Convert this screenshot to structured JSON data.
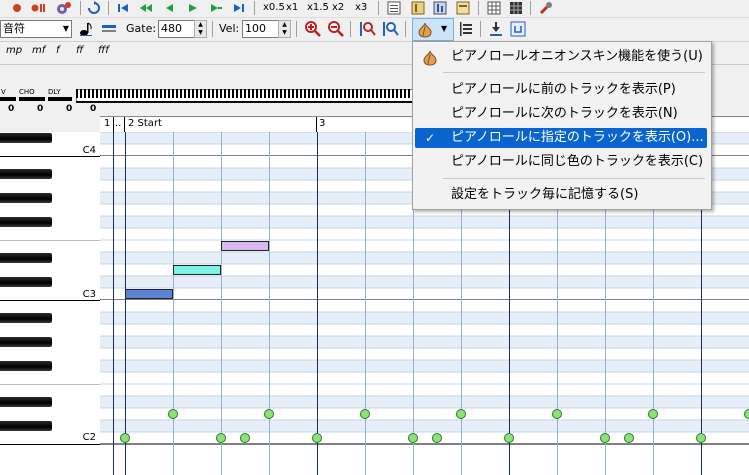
{
  "toolbar1": {
    "zoom_buttons": [
      "x0.5",
      "x1",
      "x1.5",
      "x2",
      "x3"
    ]
  },
  "toolbar2": {
    "note_combo_value": "音符",
    "gate_label": "Gate:",
    "gate_value": "480",
    "vel_label": "Vel:",
    "vel_value": "100"
  },
  "dynamics": [
    "mp",
    "mf",
    "f",
    "ff",
    "fff"
  ],
  "controllers": {
    "labels": [
      "V",
      "CHO",
      "DLY"
    ],
    "values": [
      "0",
      "0",
      "0",
      "0"
    ]
  },
  "ruler": {
    "m1": "1",
    "dots": "..",
    "m2": "2 Start",
    "m3": "3"
  },
  "keyboard": {
    "c4": "C4",
    "c3": "C3",
    "c2": "C2"
  },
  "menu": {
    "items": [
      "ピアノロールオニオンスキン機能を使う(U)",
      "ピアノロールに前のトラックを表示(P)",
      "ピアノロールに次のトラックを表示(N)",
      "ピアノロールに指定のトラックを表示(O)...",
      "ピアノロールに同じ色のトラックを表示(C)",
      "設定をトラック毎に記憶する(S)"
    ],
    "check": "✓",
    "selected_index": 3
  },
  "colors": {
    "note_blue": "#5b84d6",
    "note_cyan": "#7ff2e6",
    "note_lavender": "#d9b9f2",
    "velocity_green": "#8ee07a",
    "menu_highlight": "#0a64d0"
  }
}
